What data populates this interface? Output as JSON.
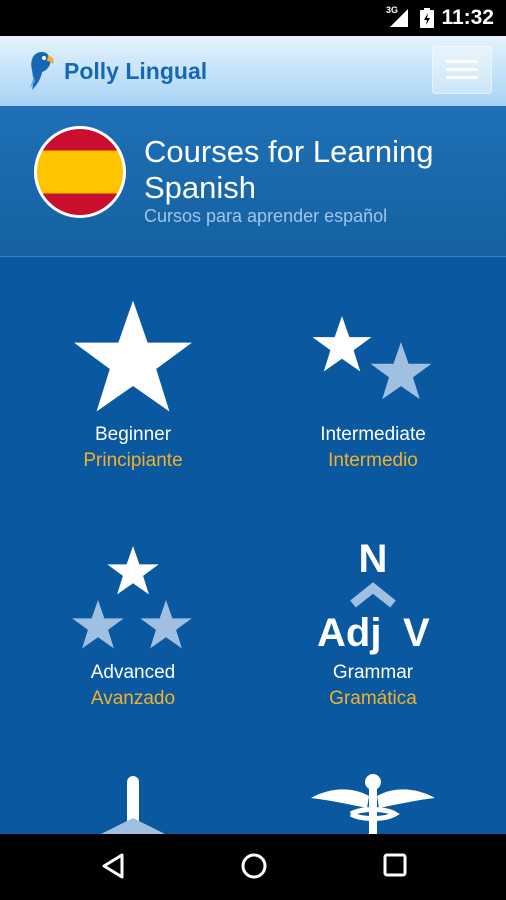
{
  "status_bar": {
    "time": "11:32",
    "network": "3G"
  },
  "app": {
    "title": "Polly Lingual",
    "logo_icon": "parrot-icon",
    "menu_icon": "hamburger-menu-icon"
  },
  "header": {
    "title": "Courses for Learning Spanish",
    "subtitle": "Cursos para aprender español",
    "flag_icon": "spain-flag-icon",
    "flag_colors": [
      "#c8102e",
      "#ffc400"
    ]
  },
  "courses": [
    {
      "en": "Beginner",
      "es": "Principiante",
      "icon": "single-star-icon"
    },
    {
      "en": "Intermediate",
      "es": "Intermedio",
      "icon": "two-stars-icon"
    },
    {
      "en": "Advanced",
      "es": "Avanzado",
      "icon": "three-stars-icon"
    },
    {
      "en": "Grammar",
      "es": "Gramática",
      "icon": "grammar-icon",
      "icon_text": {
        "top": "N",
        "left": "Adj",
        "right": "V"
      }
    },
    {
      "icon": "sword-icon"
    },
    {
      "icon": "caduceus-icon"
    }
  ],
  "colors": {
    "background": "#0a58a0",
    "accent": "#f2b12c",
    "brand": "#1668b5"
  },
  "nav_bar": {
    "back": "back-icon",
    "home": "home-icon",
    "recents": "recents-icon"
  }
}
